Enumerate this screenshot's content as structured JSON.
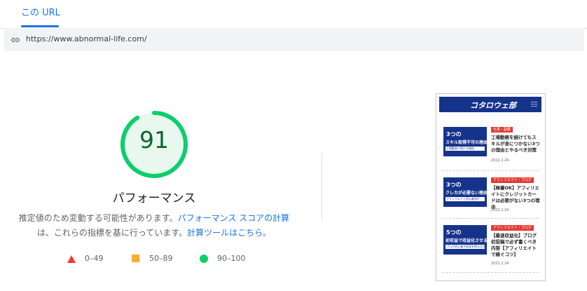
{
  "tabs": {
    "active_label": "この URL"
  },
  "url_bar": {
    "url": "https://www.abnormal-life.com/"
  },
  "gauge": {
    "score": "91",
    "score_fraction": 0.91,
    "title": "パフォーマンス",
    "color": "#0cce6b",
    "score_color": "#0d652d"
  },
  "description": {
    "text1": "推定値のため変動する可能性があります。",
    "link1": "パフォーマンス スコアの計算",
    "text2": "は、これらの指標を基に行っています。",
    "link2": "計算ツールはこちら。"
  },
  "legend": [
    {
      "shape": "triangle",
      "color": "#ff3333",
      "label": "0–49"
    },
    {
      "shape": "square",
      "color": "#ffaa33",
      "label": "50–89"
    },
    {
      "shape": "circle",
      "color": "#0cce6b",
      "label": "90–100"
    }
  ],
  "screenshot": {
    "site_logo": "コタロウェ部",
    "articles": [
      {
        "thumb_line1": "3つの",
        "thumb_line2": "スキル取得不可の理由",
        "thumb_strip": "工場勤務で続ける理由",
        "tag": "仕事・副業",
        "title": "工場勤務を続けてもスキルが身につかない3つの理由とやるべき対策",
        "date": "2022.2.24"
      },
      {
        "thumb_line1": "3つの",
        "thumb_line2": "クレカが必要ない理由",
        "thumb_strip": "アフィリエイト初心者向け",
        "tag": "アフィリエイト・ブログ",
        "title": "【無審OK】アフィリエイトにクレジットカードは必要がない3つの理由",
        "date": "2022.2.24"
      },
      {
        "thumb_line1": "5つの",
        "thumb_line2": "初収益で収益化させる",
        "thumb_strip": "ブログ初心者が収益を得る方法",
        "tag": "アフィリエイト・ブログ",
        "title": "【最速収益化】ブログ初投稿で必ず書くべき内容【アフィリエイトで稼ぐコツ】",
        "date": "2022.2.24"
      }
    ]
  }
}
